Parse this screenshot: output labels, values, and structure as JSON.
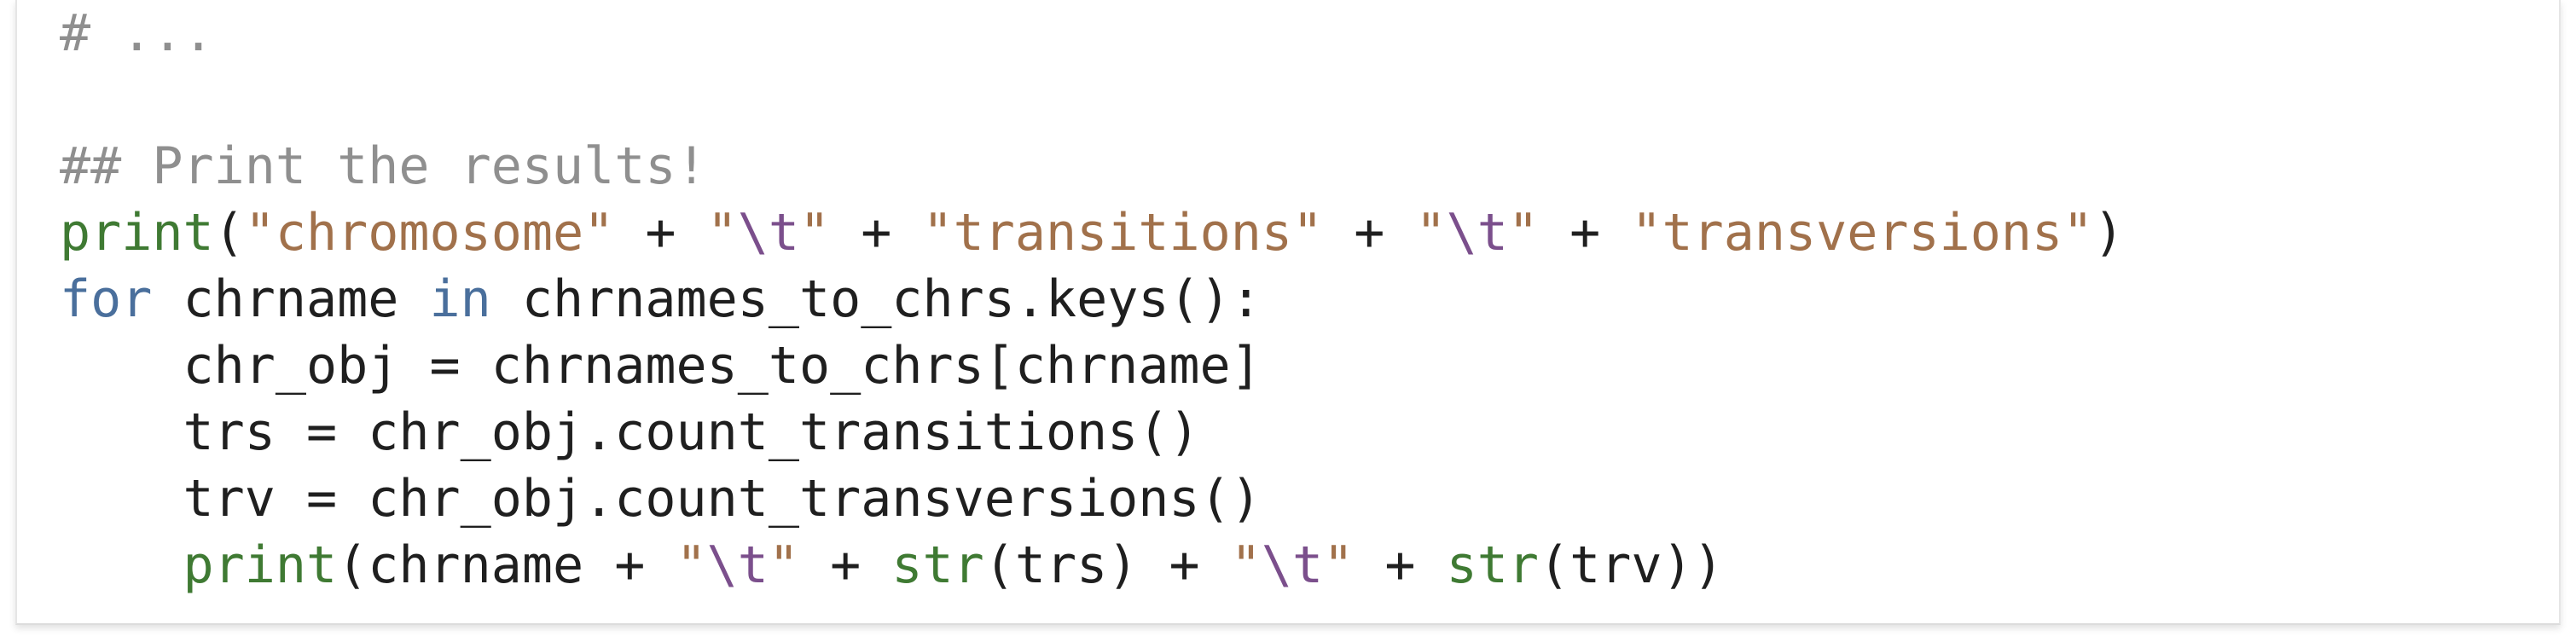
{
  "colors": {
    "comment": "#8f8f8f",
    "builtin": "#3f7a33",
    "keyword": "#4a6f9c",
    "string": "#a1714b",
    "escape": "#7b4f8c",
    "text": "#1f1f1f"
  },
  "code": {
    "lines": [
      {
        "tokens": [
          {
            "t": "# ...",
            "c": "comment"
          }
        ]
      },
      {
        "tokens": []
      },
      {
        "tokens": [
          {
            "t": "## Print the results!",
            "c": "comment"
          }
        ]
      },
      {
        "tokens": [
          {
            "t": "print",
            "c": "builtin"
          },
          {
            "t": "(",
            "c": "plain"
          },
          {
            "t": "\"chromosome\"",
            "c": "string"
          },
          {
            "t": " + ",
            "c": "plain"
          },
          {
            "t": "\"",
            "c": "string"
          },
          {
            "t": "\\t",
            "c": "escape"
          },
          {
            "t": "\"",
            "c": "string"
          },
          {
            "t": " + ",
            "c": "plain"
          },
          {
            "t": "\"transitions\"",
            "c": "string"
          },
          {
            "t": " + ",
            "c": "plain"
          },
          {
            "t": "\"",
            "c": "string"
          },
          {
            "t": "\\t",
            "c": "escape"
          },
          {
            "t": "\"",
            "c": "string"
          },
          {
            "t": " + ",
            "c": "plain"
          },
          {
            "t": "\"transversions\"",
            "c": "string"
          },
          {
            "t": ")",
            "c": "plain"
          }
        ]
      },
      {
        "tokens": [
          {
            "t": "for",
            "c": "keyword"
          },
          {
            "t": " chrname ",
            "c": "plain"
          },
          {
            "t": "in",
            "c": "keyword"
          },
          {
            "t": " chrnames_to_chrs.keys():",
            "c": "plain"
          }
        ]
      },
      {
        "tokens": [
          {
            "t": "    chr_obj = chrnames_to_chrs[chrname]",
            "c": "plain"
          }
        ]
      },
      {
        "tokens": [
          {
            "t": "    trs = chr_obj.count_transitions()",
            "c": "plain"
          }
        ]
      },
      {
        "tokens": [
          {
            "t": "    trv = chr_obj.count_transversions()",
            "c": "plain"
          }
        ]
      },
      {
        "tokens": [
          {
            "t": "    ",
            "c": "plain"
          },
          {
            "t": "print",
            "c": "builtin"
          },
          {
            "t": "(chrname + ",
            "c": "plain"
          },
          {
            "t": "\"",
            "c": "string"
          },
          {
            "t": "\\t",
            "c": "escape"
          },
          {
            "t": "\"",
            "c": "string"
          },
          {
            "t": " + ",
            "c": "plain"
          },
          {
            "t": "str",
            "c": "builtin"
          },
          {
            "t": "(trs) + ",
            "c": "plain"
          },
          {
            "t": "\"",
            "c": "string"
          },
          {
            "t": "\\t",
            "c": "escape"
          },
          {
            "t": "\"",
            "c": "string"
          },
          {
            "t": " + ",
            "c": "plain"
          },
          {
            "t": "str",
            "c": "builtin"
          },
          {
            "t": "(trv))",
            "c": "plain"
          }
        ]
      }
    ]
  }
}
